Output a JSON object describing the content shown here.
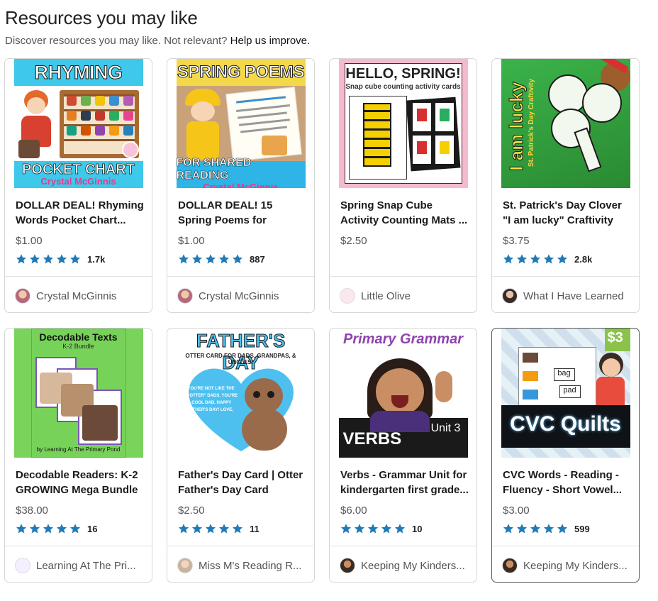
{
  "section": {
    "title": "Resources you may like",
    "subtitle": "Discover resources you may like. Not relevant?",
    "improve_link": "Help us improve."
  },
  "cards": [
    {
      "title": "DOLLAR DEAL! Rhyming Words Pocket Chart...",
      "price": "$1.00",
      "rating_count": "1.7k",
      "seller": "Crystal McGinnis",
      "thumb_text": [
        "RHYMING",
        "POCKET CHART",
        "Crystal McGinnis"
      ]
    },
    {
      "title": "DOLLAR DEAL! 15 Spring Poems for Shared...",
      "price": "$1.00",
      "rating_count": "887",
      "seller": "Crystal McGinnis",
      "thumb_text": [
        "SPRING POEMS",
        "FOR SHARED READING",
        "Crystal McGinnis"
      ]
    },
    {
      "title": "Spring Snap Cube Activity Counting Mats ...",
      "price": "$2.50",
      "rating_count": "",
      "seller": "Little Olive",
      "thumb_text": [
        "HELLO, SPRING!",
        "Snap cube counting activity cards"
      ]
    },
    {
      "title": "St. Patrick's Day Clover \"I am lucky\" Craftivity",
      "price": "$3.75",
      "rating_count": "2.8k",
      "seller": "What I Have Learned",
      "thumb_text": [
        "I am lucky",
        "St. Patrick's Day Craftivity"
      ]
    },
    {
      "title": "Decodable Readers: K-2 GROWING Mega Bundle",
      "price": "$38.00",
      "rating_count": "16",
      "seller": "Learning At The Pri...",
      "thumb_text": [
        "Decodable Texts",
        "K-2 Bundle",
        "by Learning At The Primary Pond"
      ]
    },
    {
      "title": "Father's Day Card | Otter Father's Day Card",
      "price": "$2.50",
      "rating_count": "11",
      "seller": "Miss M's Reading R...",
      "thumb_text": [
        "FATHER'S DAY",
        "OTTER CARD FOR DADS, GRANDPAS, & UNCLES!",
        "YOU'RE NOT LIKE THE \"OTTER\" DADS. YOU'RE A COOL DAD. HAPPY FATHER'S DAY! LOVE,"
      ]
    },
    {
      "title": "Verbs - Grammar Unit for kindergarten first grade...",
      "price": "$6.00",
      "rating_count": "10",
      "seller": "Keeping My Kinders...",
      "thumb_text": [
        "Primary Grammar",
        "VERBS",
        "Unit 3"
      ]
    },
    {
      "title": "CVC Words - Reading - Fluency - Short Vowel...",
      "price": "$3.00",
      "rating_count": "599",
      "seller": "Keeping My Kinders...",
      "thumb_text": [
        "CVC Quilts",
        "$3",
        "bag",
        "pad"
      ]
    }
  ],
  "colors": {
    "star": "#1f7ab8",
    "border": "#d6d6d6",
    "hover_border": "#555555"
  },
  "icons": {
    "star": "star-icon",
    "avatar": "seller-avatar"
  }
}
